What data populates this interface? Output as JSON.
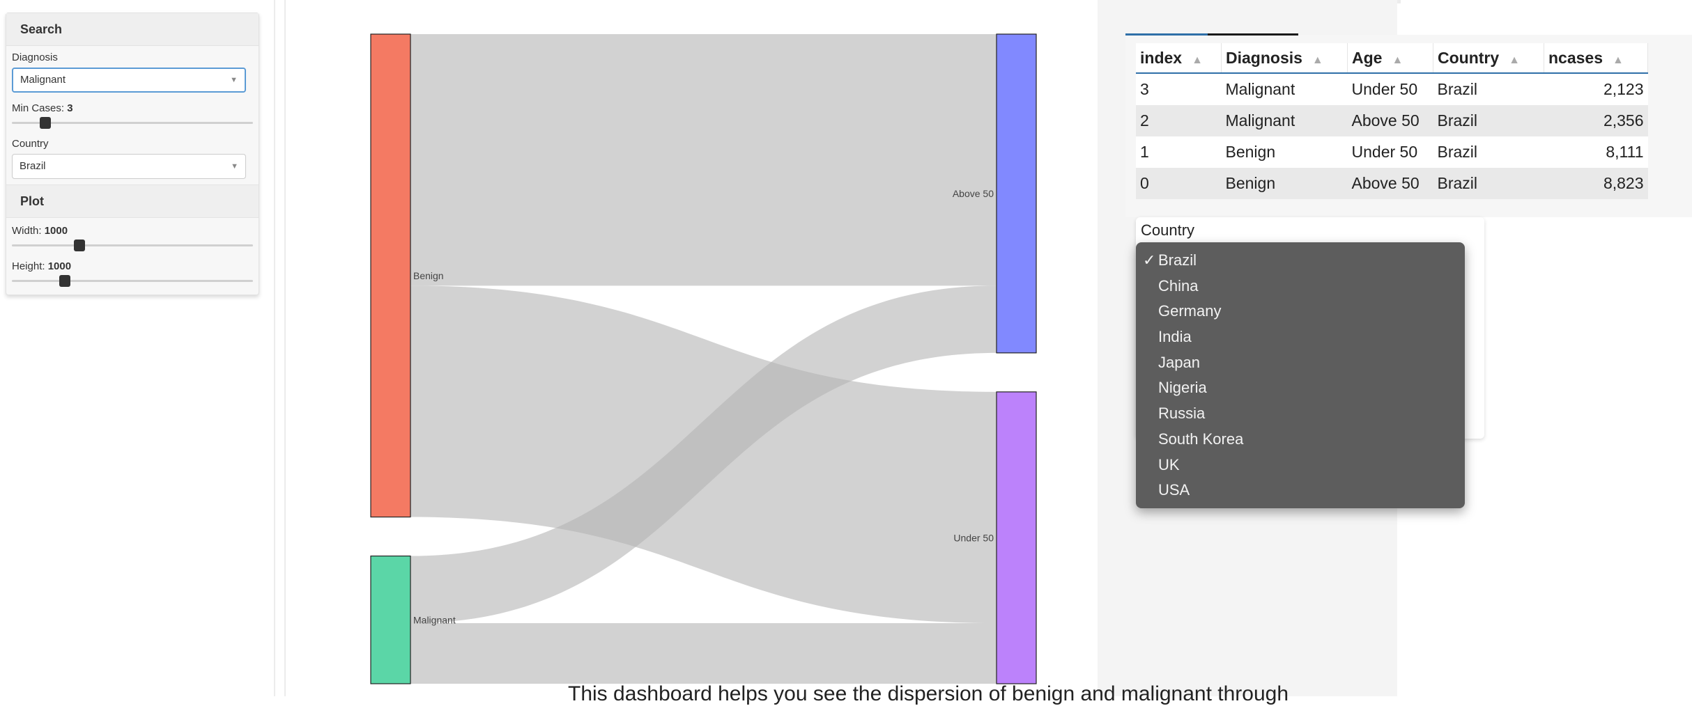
{
  "sidebar": {
    "search_header": "Search",
    "diagnosis_label": "Diagnosis",
    "diagnosis_value": "Malignant",
    "min_cases_label": "Min Cases: ",
    "min_cases_value": "3",
    "min_cases_fraction": 0.14,
    "country_label": "Country",
    "country_value": "Brazil",
    "plot_header": "Plot",
    "width_label": "Width: ",
    "width_value": "1000",
    "width_fraction": 0.28,
    "height_label": "Height: ",
    "height_value": "1000",
    "height_fraction": 0.22
  },
  "sankey": {
    "nodes": [
      {
        "name": "Benign",
        "color": "#f47a63"
      },
      {
        "name": "Malignant",
        "color": "#5bd6a7"
      },
      {
        "name": "Above 50",
        "color": "#8189ff"
      },
      {
        "name": "Under 50",
        "color": "#bc82fb"
      }
    ],
    "links": [
      {
        "source": "Benign",
        "target": "Above 50",
        "value": 8823
      },
      {
        "source": "Benign",
        "target": "Under 50",
        "value": 8111
      },
      {
        "source": "Malignant",
        "target": "Above 50",
        "value": 2356
      },
      {
        "source": "Malignant",
        "target": "Under 50",
        "value": 2123
      }
    ],
    "link_color": "#b4b4b4"
  },
  "table": {
    "columns": [
      "index",
      "Diagnosis",
      "Age",
      "Country",
      "ncases"
    ],
    "rows": [
      {
        "index": "3",
        "Diagnosis": "Malignant",
        "Age": "Under 50",
        "Country": "Brazil",
        "ncases": "2,123"
      },
      {
        "index": "2",
        "Diagnosis": "Malignant",
        "Age": "Above 50",
        "Country": "Brazil",
        "ncases": "2,356"
      },
      {
        "index": "1",
        "Diagnosis": "Benign",
        "Age": "Under 50",
        "Country": "Brazil",
        "ncases": "8,111"
      },
      {
        "index": "0",
        "Diagnosis": "Benign",
        "Age": "Above 50",
        "Country": "Brazil",
        "ncases": "8,823"
      }
    ]
  },
  "country_panel": {
    "label": "Country",
    "selected": "Brazil",
    "check_mark": "✓",
    "options": [
      "Brazil",
      "China",
      "Germany",
      "India",
      "Japan",
      "Nigeria",
      "Russia",
      "South Korea",
      "UK",
      "USA"
    ]
  },
  "footer": {
    "text": "This dashboard helps you see the dispersion of benign and malignant through"
  }
}
